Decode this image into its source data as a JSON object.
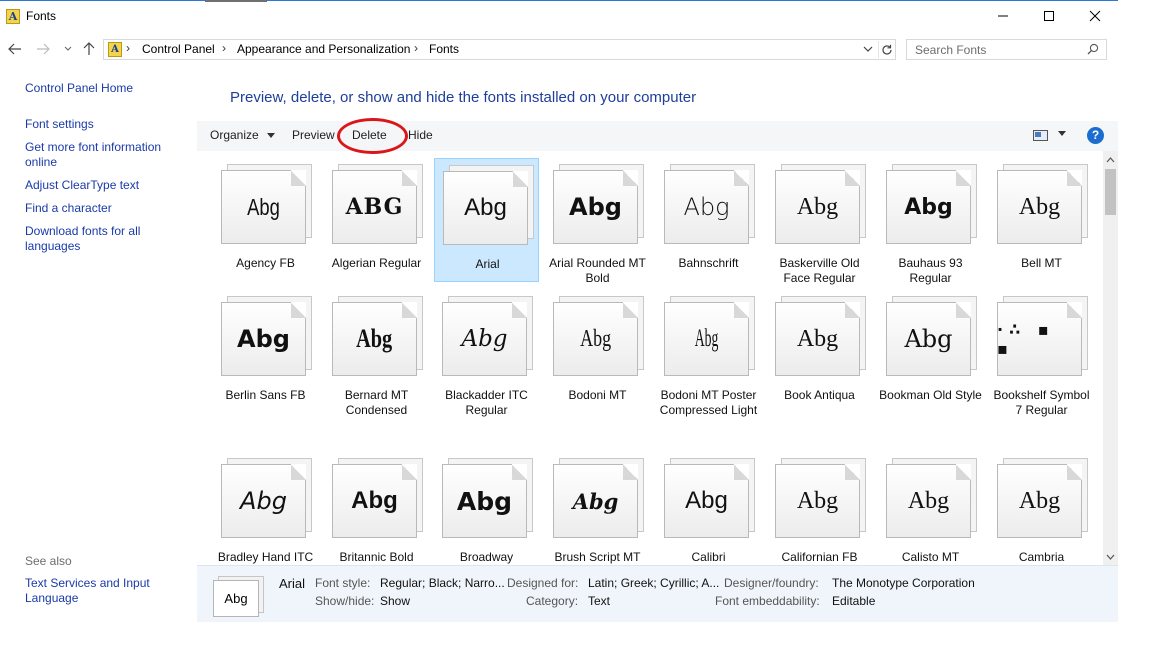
{
  "window": {
    "title": "Fonts"
  },
  "address": {
    "crumbs": [
      "Control Panel",
      "Appearance and Personalization",
      "Fonts"
    ],
    "separator": "›"
  },
  "search": {
    "placeholder": "Search Fonts"
  },
  "left_pane": {
    "home": "Control Panel Home",
    "links": [
      "Font settings",
      "Get more font information online",
      "Adjust ClearType text",
      "Find a character",
      "Download fonts for all languages"
    ],
    "see_also_title": "See also",
    "see_also_links": [
      "Text Services and Input Language"
    ]
  },
  "heading": "Preview, delete, or show and hide the fonts installed on your computer",
  "toolbar": {
    "organize": "Organize",
    "preview": "Preview",
    "delete": "Delete",
    "hide": "Hide",
    "help": "?"
  },
  "fonts": [
    {
      "name": "Agency FB",
      "sample": "Abg"
    },
    {
      "name": "Algerian Regular",
      "sample": "ABG"
    },
    {
      "name": "Arial",
      "sample": "Abg",
      "selected": true
    },
    {
      "name": "Arial Rounded MT Bold",
      "sample": "Abg"
    },
    {
      "name": "Bahnschrift",
      "sample": "Abg"
    },
    {
      "name": "Baskerville Old Face Regular",
      "sample": "Abg"
    },
    {
      "name": "Bauhaus 93 Regular",
      "sample": "Abg"
    },
    {
      "name": "Bell MT",
      "sample": "Abg"
    },
    {
      "name": "Berlin Sans FB",
      "sample": "Abg"
    },
    {
      "name": "Bernard MT Condensed",
      "sample": "Abg"
    },
    {
      "name": "Blackadder ITC Regular",
      "sample": "Abg"
    },
    {
      "name": "Bodoni MT",
      "sample": "Abg"
    },
    {
      "name": "Bodoni MT Poster Compressed Light",
      "sample": "Abg"
    },
    {
      "name": "Book Antiqua",
      "sample": "Abg"
    },
    {
      "name": "Bookman Old Style",
      "sample": "Abg"
    },
    {
      "name": "Bookshelf Symbol 7 Regular",
      "sample": "·∴ ▪ ▪"
    },
    {
      "name": "Bradley Hand ITC",
      "sample": "Abg"
    },
    {
      "name": "Britannic Bold",
      "sample": "Abg"
    },
    {
      "name": "Broadway",
      "sample": "Abg"
    },
    {
      "name": "Brush Script MT",
      "sample": "Abg"
    },
    {
      "name": "Calibri",
      "sample": "Abg"
    },
    {
      "name": "Californian FB",
      "sample": "Abg"
    },
    {
      "name": "Calisto MT",
      "sample": "Abg"
    },
    {
      "name": "Cambria",
      "sample": "Abg"
    }
  ],
  "details": {
    "thumb_sample": "Abg",
    "font_name": "Arial",
    "font_style_label": "Font style:",
    "font_style": "Regular; Black; Narro...",
    "show_hide_label": "Show/hide:",
    "show_hide": "Show",
    "designed_for_label": "Designed for:",
    "designed_for": "Latin; Greek; Cyrillic; A...",
    "category_label": "Category:",
    "category": "Text",
    "designer_label": "Designer/foundry:",
    "designer": "The Monotype Corporation",
    "embed_label": "Font embeddability:",
    "embed": "Editable"
  },
  "colors": {
    "link": "#1a3aa8",
    "heading": "#1e3e9a",
    "selection": "#cce8ff",
    "annotation": "#d9161a"
  }
}
